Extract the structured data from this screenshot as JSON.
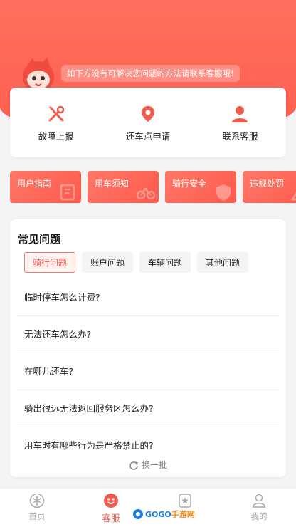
{
  "banner": {
    "tip": "如下方没有可解决您问题的方法请联系客服哦!"
  },
  "quick_actions": [
    {
      "label": "故障上报",
      "icon": "wrench-screwdriver-icon"
    },
    {
      "label": "还车点申请",
      "icon": "location-pin-icon"
    },
    {
      "label": "联系客服",
      "icon": "customer-service-icon"
    }
  ],
  "guides": [
    {
      "label": "用户指南",
      "icon": "book-icon"
    },
    {
      "label": "用车须知",
      "icon": "bicycle-icon"
    },
    {
      "label": "骑行安全",
      "icon": "shield-icon"
    },
    {
      "label": "违规处罚",
      "icon": "warning-icon"
    }
  ],
  "faq": {
    "title": "常见问题",
    "tabs": [
      "骑行问题",
      "账户问题",
      "车辆问题",
      "其他问题"
    ],
    "active_tab": 0,
    "questions": [
      "临时停车怎么计费?",
      "无法还车怎么办?",
      "在哪儿还车?",
      "骑出很远无法返回服务区怎么办?",
      "用车时有哪些行为是严格禁止的?"
    ],
    "refresh_label": "换一批"
  },
  "tabbar": {
    "items": [
      {
        "label": "首页",
        "icon": "snowflake-icon"
      },
      {
        "label": "客服",
        "icon": "smiley-icon"
      },
      {
        "label": "",
        "icon": "star-card-icon"
      },
      {
        "label": "我的",
        "icon": "user-icon"
      }
    ],
    "active": 1
  },
  "watermark": {
    "brand": "GOGO",
    "suffix": "手游网"
  },
  "colors": {
    "accent": "#f25a4a",
    "hero": "#ff6a5a"
  }
}
